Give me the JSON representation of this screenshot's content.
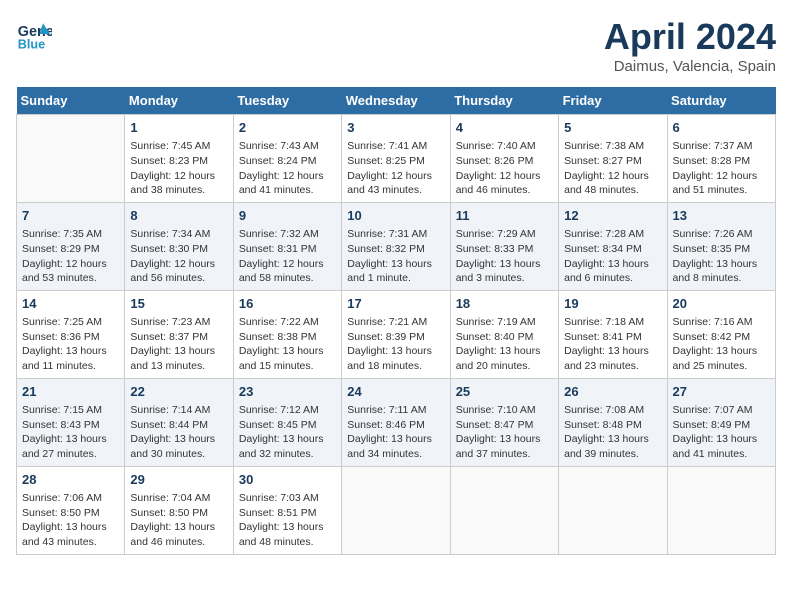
{
  "header": {
    "logo_line1": "General",
    "logo_line2": "Blue",
    "month": "April 2024",
    "location": "Daimus, Valencia, Spain"
  },
  "weekdays": [
    "Sunday",
    "Monday",
    "Tuesday",
    "Wednesday",
    "Thursday",
    "Friday",
    "Saturday"
  ],
  "weeks": [
    [
      {
        "day": "",
        "info": ""
      },
      {
        "day": "1",
        "info": "Sunrise: 7:45 AM\nSunset: 8:23 PM\nDaylight: 12 hours\nand 38 minutes."
      },
      {
        "day": "2",
        "info": "Sunrise: 7:43 AM\nSunset: 8:24 PM\nDaylight: 12 hours\nand 41 minutes."
      },
      {
        "day": "3",
        "info": "Sunrise: 7:41 AM\nSunset: 8:25 PM\nDaylight: 12 hours\nand 43 minutes."
      },
      {
        "day": "4",
        "info": "Sunrise: 7:40 AM\nSunset: 8:26 PM\nDaylight: 12 hours\nand 46 minutes."
      },
      {
        "day": "5",
        "info": "Sunrise: 7:38 AM\nSunset: 8:27 PM\nDaylight: 12 hours\nand 48 minutes."
      },
      {
        "day": "6",
        "info": "Sunrise: 7:37 AM\nSunset: 8:28 PM\nDaylight: 12 hours\nand 51 minutes."
      }
    ],
    [
      {
        "day": "7",
        "info": "Sunrise: 7:35 AM\nSunset: 8:29 PM\nDaylight: 12 hours\nand 53 minutes."
      },
      {
        "day": "8",
        "info": "Sunrise: 7:34 AM\nSunset: 8:30 PM\nDaylight: 12 hours\nand 56 minutes."
      },
      {
        "day": "9",
        "info": "Sunrise: 7:32 AM\nSunset: 8:31 PM\nDaylight: 12 hours\nand 58 minutes."
      },
      {
        "day": "10",
        "info": "Sunrise: 7:31 AM\nSunset: 8:32 PM\nDaylight: 13 hours\nand 1 minute."
      },
      {
        "day": "11",
        "info": "Sunrise: 7:29 AM\nSunset: 8:33 PM\nDaylight: 13 hours\nand 3 minutes."
      },
      {
        "day": "12",
        "info": "Sunrise: 7:28 AM\nSunset: 8:34 PM\nDaylight: 13 hours\nand 6 minutes."
      },
      {
        "day": "13",
        "info": "Sunrise: 7:26 AM\nSunset: 8:35 PM\nDaylight: 13 hours\nand 8 minutes."
      }
    ],
    [
      {
        "day": "14",
        "info": "Sunrise: 7:25 AM\nSunset: 8:36 PM\nDaylight: 13 hours\nand 11 minutes."
      },
      {
        "day": "15",
        "info": "Sunrise: 7:23 AM\nSunset: 8:37 PM\nDaylight: 13 hours\nand 13 minutes."
      },
      {
        "day": "16",
        "info": "Sunrise: 7:22 AM\nSunset: 8:38 PM\nDaylight: 13 hours\nand 15 minutes."
      },
      {
        "day": "17",
        "info": "Sunrise: 7:21 AM\nSunset: 8:39 PM\nDaylight: 13 hours\nand 18 minutes."
      },
      {
        "day": "18",
        "info": "Sunrise: 7:19 AM\nSunset: 8:40 PM\nDaylight: 13 hours\nand 20 minutes."
      },
      {
        "day": "19",
        "info": "Sunrise: 7:18 AM\nSunset: 8:41 PM\nDaylight: 13 hours\nand 23 minutes."
      },
      {
        "day": "20",
        "info": "Sunrise: 7:16 AM\nSunset: 8:42 PM\nDaylight: 13 hours\nand 25 minutes."
      }
    ],
    [
      {
        "day": "21",
        "info": "Sunrise: 7:15 AM\nSunset: 8:43 PM\nDaylight: 13 hours\nand 27 minutes."
      },
      {
        "day": "22",
        "info": "Sunrise: 7:14 AM\nSunset: 8:44 PM\nDaylight: 13 hours\nand 30 minutes."
      },
      {
        "day": "23",
        "info": "Sunrise: 7:12 AM\nSunset: 8:45 PM\nDaylight: 13 hours\nand 32 minutes."
      },
      {
        "day": "24",
        "info": "Sunrise: 7:11 AM\nSunset: 8:46 PM\nDaylight: 13 hours\nand 34 minutes."
      },
      {
        "day": "25",
        "info": "Sunrise: 7:10 AM\nSunset: 8:47 PM\nDaylight: 13 hours\nand 37 minutes."
      },
      {
        "day": "26",
        "info": "Sunrise: 7:08 AM\nSunset: 8:48 PM\nDaylight: 13 hours\nand 39 minutes."
      },
      {
        "day": "27",
        "info": "Sunrise: 7:07 AM\nSunset: 8:49 PM\nDaylight: 13 hours\nand 41 minutes."
      }
    ],
    [
      {
        "day": "28",
        "info": "Sunrise: 7:06 AM\nSunset: 8:50 PM\nDaylight: 13 hours\nand 43 minutes."
      },
      {
        "day": "29",
        "info": "Sunrise: 7:04 AM\nSunset: 8:50 PM\nDaylight: 13 hours\nand 46 minutes."
      },
      {
        "day": "30",
        "info": "Sunrise: 7:03 AM\nSunset: 8:51 PM\nDaylight: 13 hours\nand 48 minutes."
      },
      {
        "day": "",
        "info": ""
      },
      {
        "day": "",
        "info": ""
      },
      {
        "day": "",
        "info": ""
      },
      {
        "day": "",
        "info": ""
      }
    ]
  ]
}
